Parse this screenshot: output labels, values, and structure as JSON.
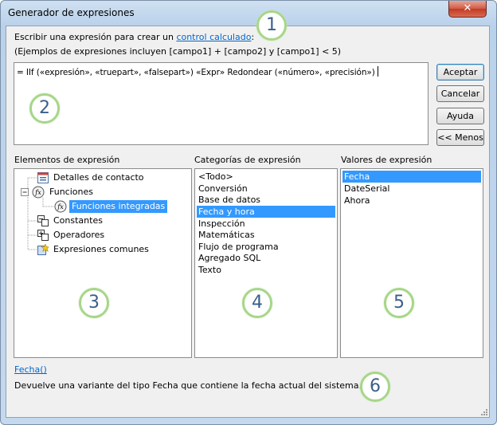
{
  "window": {
    "title": "Generador de expresiones",
    "close_label": "✕"
  },
  "instructions": {
    "line1_prefix": "Escribir una expresión para crear un ",
    "line1_link": "control calculado",
    "line1_suffix": ":",
    "line2": "(Ejemplos de expresiones incluyen [campo1] + [campo2] y [campo1] < 5)"
  },
  "expression": {
    "value": "= IIf («expresión», «truepart», «falsepart») «Expr» Redondear («número», «precisión»)"
  },
  "buttons": {
    "ok": "Aceptar",
    "cancel": "Cancelar",
    "help": "Ayuda",
    "less": "<< Menos"
  },
  "elements": {
    "label": "Elementos de expresión",
    "items": [
      {
        "label": "Detalles de contacto",
        "icon": "form-icon"
      },
      {
        "label": "Funciones",
        "icon": "function-icon"
      },
      {
        "label": "Funciones integradas",
        "icon": "function-icon",
        "selected": true
      },
      {
        "label": "Constantes",
        "icon": "constants-icon"
      },
      {
        "label": "Operadores",
        "icon": "operators-icon"
      },
      {
        "label": "Expresiones comunes",
        "icon": "common-expressions-icon"
      }
    ]
  },
  "categories": {
    "label": "Categorías de expresión",
    "items": [
      "<Todo>",
      "Conversión",
      "Base de datos",
      "Fecha y hora",
      "Inspección",
      "Matemáticas",
      "Flujo de programa",
      "Agregado SQL",
      "Texto"
    ],
    "selected": "Fecha y hora"
  },
  "values": {
    "label": "Valores de expresión",
    "items": [
      "Fecha",
      "DateSerial",
      "Ahora"
    ],
    "selected": "Fecha"
  },
  "help": {
    "function_link": "Fecha()",
    "description": "Devuelve una variante del tipo Fecha que contiene la fecha actual del sistema."
  },
  "callouts": [
    "1",
    "2",
    "3",
    "4",
    "5",
    "6"
  ],
  "colors": {
    "selection": "#3399ff",
    "link": "#0066cc",
    "callout_ring": "#a7d68a",
    "callout_text": "#3b5f8a"
  }
}
